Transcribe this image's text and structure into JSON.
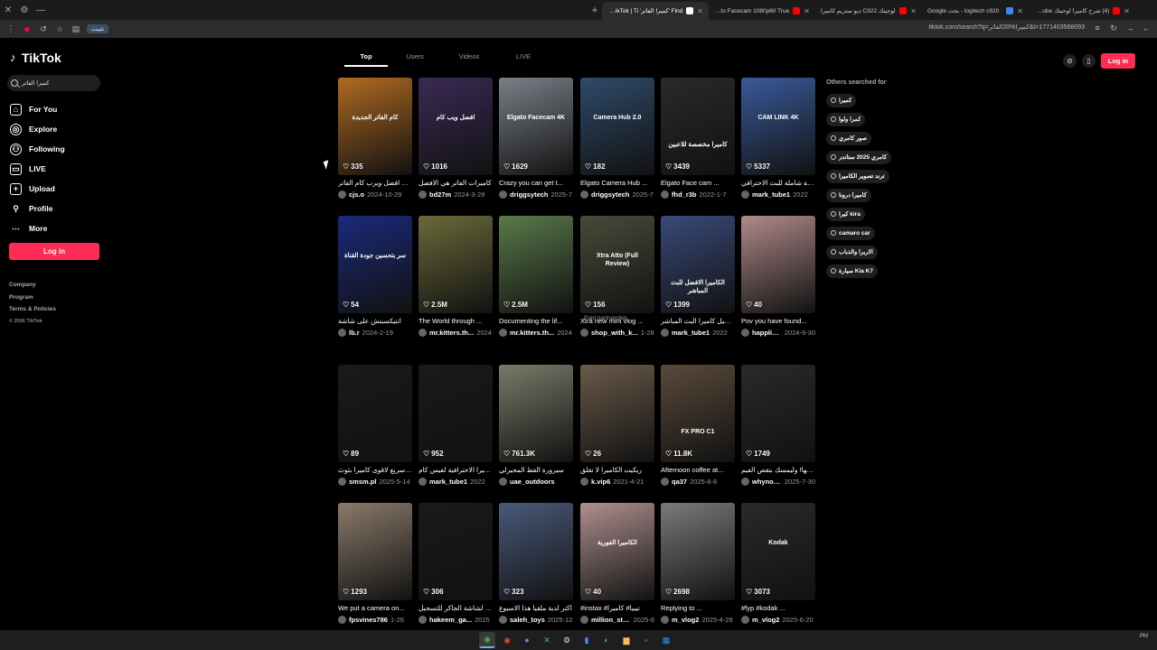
{
  "browser": {
    "tabs": [
      {
        "title": "Find 'كميرا الفاتر' on TikTok | Ti",
        "active": true,
        "favicon_color": "#ffffff"
      },
      {
        "title": "Elgato Facecam 1080p60 True",
        "active": false,
        "favicon_color": "#ff0000"
      },
      {
        "title": "لوجيتك C922 ديو ستريم كاميرا",
        "active": false,
        "favicon_color": "#ff0000"
      },
      {
        "title": "logitech c920 - بحث Google",
        "active": false,
        "favicon_color": "#4285f4"
      },
      {
        "title": "(4) شرح كاميرا لوجيتك YouTube",
        "active": false,
        "favicon_color": "#ff0000"
      }
    ],
    "install_label": "تثبيت",
    "url": "tiktok.com/search?q=كميرا%20الفاتر&t=1771403568093"
  },
  "logo": {
    "text": "TikTok"
  },
  "search": {
    "value": "كميرا الفاتر"
  },
  "nav": [
    {
      "label": "For You",
      "icon": "home-icon"
    },
    {
      "label": "Explore",
      "icon": "compass-icon"
    },
    {
      "label": "Following",
      "icon": "users-icon"
    },
    {
      "label": "LIVE",
      "icon": "live-icon"
    },
    {
      "label": "Upload",
      "icon": "plus-icon"
    },
    {
      "label": "Profile",
      "icon": "person-icon"
    },
    {
      "label": "More",
      "icon": "more-icon"
    }
  ],
  "login_label": "Log in",
  "footer": {
    "company": "Company",
    "program": "Program",
    "terms": "Terms & Policies",
    "copyright": "© 2026 TikTok"
  },
  "main_tabs": [
    "Top",
    "Users",
    "Videos",
    "LIVE"
  ],
  "others": {
    "title": "Others searched for",
    "items": [
      "كميرا",
      "كمرا ولوا",
      "صور كامري",
      "كامري 2025 ستاندر",
      "ترند تصوير الكاميرا",
      "كاميرا درونا",
      "كيرا kira",
      "camaro car",
      "الاربرا والذباب",
      "سيارة Kia K7"
    ]
  },
  "videos": [
    {
      "likes": "335",
      "caption": "هاذي افضل ويرب كام الفاتر",
      "user": "cjs.o",
      "date": "2024-10-29",
      "overlay": "كام الفاتر الجديدة",
      "bg": "#b06a22"
    },
    {
      "likes": "1016",
      "caption": "كاميرات الفاتر هي الافضل",
      "user": "bd27m",
      "date": "2024-3-28",
      "overlay": "افضل ويب كام",
      "bg": "#3a2a55"
    },
    {
      "likes": "1629",
      "caption": "Crazy you can get t...",
      "user": "driggsytech",
      "date": "2025-7",
      "overlay": "Elgato Facecam 4K",
      "bg": "#7a8088"
    },
    {
      "likes": "182",
      "caption": "Elgato Camera Hub ...",
      "user": "driggsytech",
      "date": "2025-7",
      "overlay": "Camera Hub 2.0",
      "bg": "#2f4a6a"
    },
    {
      "likes": "3439",
      "caption": "Elgato Face cam ...",
      "user": "fhd_r3b",
      "date": "2022-1-7",
      "overlay": "كاميرا مخصصة للاعبين",
      "bg": "#2a2a2a"
    },
    {
      "likes": "5337",
      "caption": "مراجعة شاملة للبث الاحترافي",
      "user": "mark_tube1",
      "date": "2022",
      "overlay": "CAM LINK 4K",
      "bg": "#3a5a9a"
    },
    {
      "likes": "54",
      "caption": "انتيكسبتش على شاشة",
      "user": "lb.r",
      "date": "2024-2-19",
      "overlay": "سر بتحسين جودة القناة",
      "bg": "#1a2a7a"
    },
    {
      "likes": "2.5M",
      "caption": "The World through ...",
      "user": "mr.kitters.th...",
      "date": "2024",
      "overlay": "",
      "bg": "#6a6a3a"
    },
    {
      "likes": "2.5M",
      "caption": "Documenting the lif...",
      "user": "mr.kitters.th...",
      "date": "2024",
      "overlay": "",
      "bg": "#5a7a4a"
    },
    {
      "likes": "156",
      "caption": "Xtra new mini vlog ...",
      "user": "shop_with_k...",
      "date": "1-28",
      "overlay": "Xtra Atto (Full Review)",
      "bg": "#4a4a3a",
      "partnership": "Paid partnership"
    },
    {
      "likes": "1399",
      "caption": "ترسيل كاميرا البث المباشر",
      "user": "mark_tube1",
      "date": "2022",
      "overlay": "الكاميرا الافضل للبث المباشر",
      "bg": "#3a4a7a"
    },
    {
      "likes": "40",
      "caption": "Pov you have found...",
      "user": "happlicam",
      "date": "2024-9-30",
      "overlay": "",
      "bg": "#b08a8a"
    },
    {
      "likes": "89",
      "caption": "نتي سريع لاقوى كاميرا بثوث",
      "user": "smsm.pl",
      "date": "2025-5-14",
      "overlay": "",
      "bg": "#1a1a1a"
    },
    {
      "likes": "952",
      "caption": "الكاميرا الاحترافية لفيس كام",
      "user": "mark_tube1",
      "date": "2022",
      "overlay": "",
      "bg": "#1a1a1a"
    },
    {
      "likes": "761.3K",
      "caption": "سيرورة القط المحيرلي",
      "user": "uae_outdoors",
      "date": "",
      "overlay": "",
      "bg": "#7a7a6a"
    },
    {
      "likes": "26",
      "caption": "ريكيت الكاميرا لا تقلق",
      "user": "k.vip6",
      "date": "2021-4-21",
      "overlay": "",
      "bg": "#6a5a4a"
    },
    {
      "likes": "11.8K",
      "caption": "Afternoon coffee at...",
      "user": "qa37",
      "date": "2025-8-8",
      "overlay": "FX PRO C1",
      "bg": "#5a4a3a"
    },
    {
      "likes": "1749",
      "caption": "فاحسها! وليمسك بتقص الفيم",
      "user": "whynotshin...",
      "date": "2025-7-30",
      "overlay": "",
      "bg": "#2a2a2a"
    },
    {
      "likes": "1293",
      "caption": "We put a camera on...",
      "user": "fpsvines786",
      "date": "1-26",
      "overlay": "",
      "bg": "#8a7a6a"
    },
    {
      "likes": "306",
      "caption": "ويب كام لشاشة الجاكر للتسجيل",
      "user": "hakeem_ga...",
      "date": "2025",
      "overlay": "",
      "bg": "#1a1a1a"
    },
    {
      "likes": "323",
      "caption": "اكتر لدية ملقيا هذا الاسبوع",
      "user": "saleh_toys",
      "date": "2025-12",
      "overlay": "",
      "bg": "#4a5a7a"
    },
    {
      "likes": "40",
      "caption": "#instax #تيبيا# كاميرا",
      "user": "million_stor1",
      "date": "2025-6",
      "overlay": "الكاميرا الفورية",
      "bg": "#b09090"
    },
    {
      "likes": "2698",
      "caption": "Replying to ...",
      "user": "m_vlog2",
      "date": "2025-4-28",
      "overlay": "",
      "bg": "#7a7a7a"
    },
    {
      "likes": "3073",
      "caption": "#fyp #kodak ...",
      "user": "m_vlog2",
      "date": "2025-6-20",
      "overlay": "Kodak",
      "bg": "#2a2a2a"
    }
  ],
  "taskbar": {
    "tray_time": "PM"
  }
}
